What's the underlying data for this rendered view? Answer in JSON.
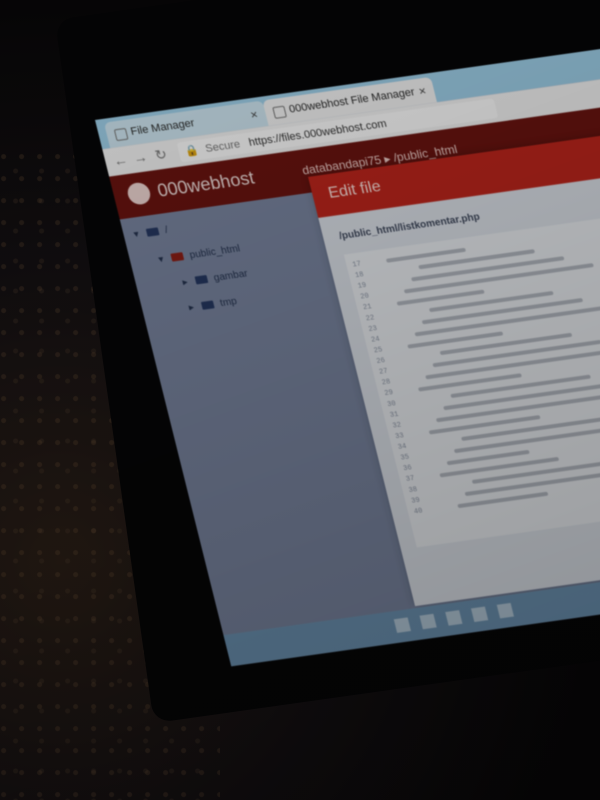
{
  "browser": {
    "tabs": [
      {
        "label": "File Manager"
      },
      {
        "label": "000webhost File Manager"
      }
    ],
    "url_secure": "Secure",
    "url": "https://files.000webhost.com"
  },
  "app": {
    "brand": "000webhost",
    "breadcrumb": "databandapi75 ▸ /public_html"
  },
  "sidebar": {
    "root": "/",
    "items": [
      {
        "label": "public_html"
      },
      {
        "label": "gambar"
      },
      {
        "label": "tmp"
      }
    ]
  },
  "modal": {
    "title": "Edit file",
    "path": "/public_html/listkomentar.php"
  },
  "editor": {
    "line_numbers": [
      "17",
      "18",
      "19",
      "20",
      "21",
      "22",
      "23",
      "24",
      "25",
      "26",
      "27",
      "28",
      "29",
      "30",
      "31",
      "32",
      "33",
      "34",
      "35",
      "36",
      "37",
      "38",
      "39",
      "40"
    ]
  },
  "colors": {
    "header_bar": "#6b1410",
    "modal_header": "#c1261c",
    "sidebar_bg": "#7b87a2",
    "taskbar": "#6f96b6"
  }
}
